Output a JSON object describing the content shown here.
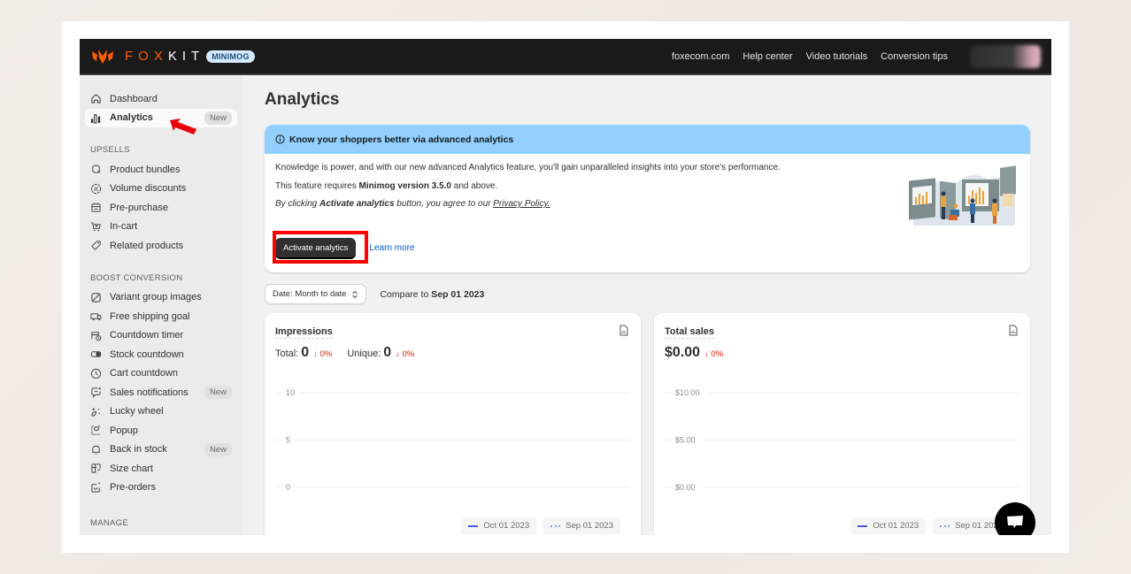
{
  "topbar": {
    "logo_text_orange": "FOX",
    "logo_text_white": "KIT",
    "brand_badge": "MINIMOG",
    "links": [
      "foxecom.com",
      "Help center",
      "Video tutorials",
      "Conversion tips"
    ]
  },
  "sidebar": {
    "top_items": [
      {
        "label": "Dashboard",
        "icon": "home-icon"
      },
      {
        "label": "Analytics",
        "icon": "analytics-icon",
        "badge": "New",
        "active": true
      }
    ],
    "sections": [
      {
        "title": "UPSELLS",
        "items": [
          {
            "label": "Product bundles",
            "icon": "bundle-icon"
          },
          {
            "label": "Volume discounts",
            "icon": "discount-icon"
          },
          {
            "label": "Pre-purchase",
            "icon": "pre-purchase-icon"
          },
          {
            "label": "In-cart",
            "icon": "cart-icon"
          },
          {
            "label": "Related products",
            "icon": "tag-icon"
          }
        ]
      },
      {
        "title": "BOOST CONVERSION",
        "items": [
          {
            "label": "Variant group images",
            "icon": "image-icon"
          },
          {
            "label": "Free shipping goal",
            "icon": "truck-icon"
          },
          {
            "label": "Countdown timer",
            "icon": "calendar-clock-icon"
          },
          {
            "label": "Stock countdown",
            "icon": "stock-icon"
          },
          {
            "label": "Cart countdown",
            "icon": "clock-icon"
          },
          {
            "label": "Sales notifications",
            "icon": "chat-notification-icon",
            "badge": "New"
          },
          {
            "label": "Lucky wheel",
            "icon": "sparkle-icon"
          },
          {
            "label": "Popup",
            "icon": "popup-icon"
          },
          {
            "label": "Back in stock",
            "icon": "bell-icon",
            "badge": "New"
          },
          {
            "label": "Size chart",
            "icon": "size-chart-icon"
          },
          {
            "label": "Pre-orders",
            "icon": "pre-order-icon"
          }
        ]
      },
      {
        "title": "MANAGE",
        "items": []
      }
    ]
  },
  "main": {
    "page_title": "Analytics",
    "banner": {
      "heading": "Know your shoppers better via advanced analytics",
      "line1": "Knowledge is power, and with our new advanced Analytics feature, you'll gain unparalleled insights into your store's performance.",
      "line2_pre": "This feature requires ",
      "line2_bold": "Minimog version 3.5.0",
      "line2_post": " and above.",
      "line3_pre": "By clicking ",
      "line3_bold": "Activate analytics",
      "line3_mid": " button, you agree to our ",
      "line3_link": "Privacy Policy.",
      "activate_button": "Activate analytics",
      "learn_more": "Learn more"
    },
    "filters": {
      "date_select": "Date: Month to date",
      "compare_prefix": "Compare to ",
      "compare_date": "Sep 01 2023"
    },
    "cards": {
      "impressions": {
        "title": "Impressions",
        "total_label": "Total:",
        "total_value": "0",
        "total_change": "↓ 0%",
        "unique_label": "Unique:",
        "unique_value": "0",
        "unique_change": "↓ 0%"
      },
      "sales": {
        "title": "Total sales",
        "value": "$0.00",
        "change": "↓ 0%"
      }
    }
  },
  "chart_data": [
    {
      "type": "line",
      "title": "Impressions",
      "ylim": [
        0,
        10
      ],
      "yticks": [
        "10",
        "5",
        "0"
      ],
      "ytick_values": [
        10,
        5,
        0
      ],
      "grid": true,
      "legend_position": "bottom-right",
      "series": [
        {
          "name": "Oct 01 2023",
          "style": "solid",
          "color": "#4c59d8",
          "values": []
        },
        {
          "name": "Sep 01 2023",
          "style": "dotted",
          "color": "#7ea7e8",
          "values": []
        }
      ]
    },
    {
      "type": "line",
      "title": "Total sales",
      "ylim": [
        0,
        10
      ],
      "yticks": [
        "$10.00",
        "$5.00",
        "$0.00"
      ],
      "ytick_values": [
        10,
        5,
        0
      ],
      "grid": true,
      "legend_position": "bottom-right",
      "series": [
        {
          "name": "Oct 01 2023",
          "style": "solid",
          "color": "#4c59d8",
          "values": []
        },
        {
          "name": "Sep 01 2023",
          "style": "dotted",
          "color": "#7ea7e8",
          "values": []
        }
      ]
    }
  ]
}
